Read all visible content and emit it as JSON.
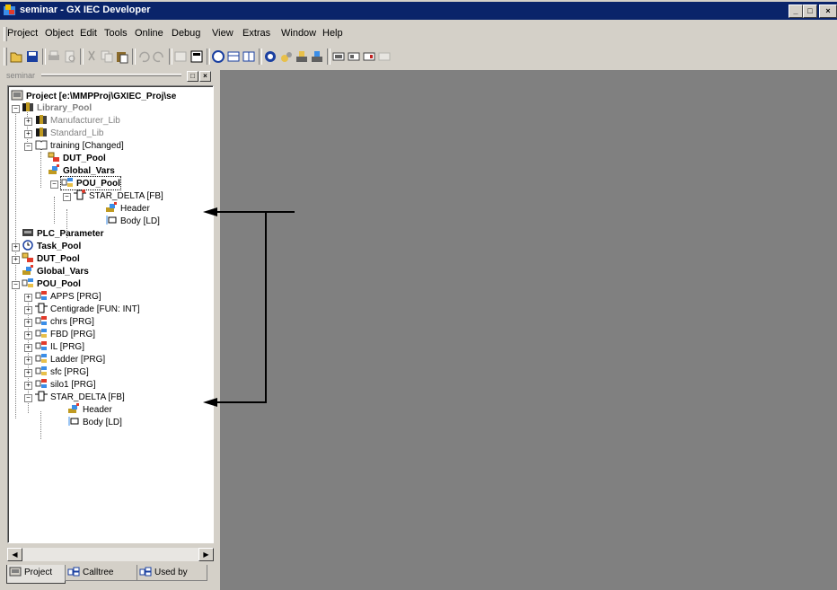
{
  "window": {
    "title": "seminar - GX IEC Developer",
    "controls": [
      "_",
      "□",
      "×"
    ]
  },
  "menu": [
    "Project",
    "Object",
    "Edit",
    "Tools",
    "Online",
    "Debug",
    "View",
    "Extras",
    "Window",
    "Help"
  ],
  "toolbar": {
    "icons": [
      "new-icon",
      "save-icon",
      "print-icon",
      "print-preview-icon",
      "cut-icon",
      "copy-icon",
      "paste-icon",
      "undo-icon",
      "redo-icon",
      "open-object-icon",
      "compile-icon",
      "monitor-icon",
      "entry-data-monitor-icon",
      "watch-icon",
      "online-icon",
      "transfer-icon",
      "download-icon",
      "upload-icon",
      "device-edit-icon",
      "variable-edit-icon",
      "cross-ref-icon",
      "disabled-icon"
    ]
  },
  "panel": {
    "title": "seminar",
    "tree": {
      "root": "Project [e:\\MMPProj\\GXIEC_Proj\\se",
      "library_pool": "Library_Pool",
      "manufacturer_lib": "Manufacturer_Lib",
      "standard_lib": "Standard_Lib",
      "training": "training [Changed]",
      "lib_dut_pool": "DUT_Pool",
      "lib_global_vars": "Global_Vars",
      "lib_pou_pool": "POU_Pool",
      "lib_star_delta": "STAR_DELTA [FB]",
      "lib_header": "Header",
      "lib_body": "Body [LD]",
      "plc_parameter": "PLC_Parameter",
      "task_pool": "Task_Pool",
      "dut_pool": "DUT_Pool",
      "global_vars": "Global_Vars",
      "pou_pool": "POU_Pool",
      "pous": [
        "APPS [PRG]",
        "Centigrade [FUN: INT]",
        "chrs [PRG]",
        "FBD [PRG]",
        "IL [PRG]",
        "Ladder [PRG]",
        "sfc [PRG]",
        "silo1 [PRG]"
      ],
      "star_delta": "STAR_DELTA [FB]",
      "header": "Header",
      "body": "Body [LD]"
    },
    "tabs": [
      "Project",
      "Calltree",
      "Used by"
    ]
  },
  "colors": {
    "titlebar": "#0a246a",
    "face": "#d4d0c8",
    "workspace": "#808080",
    "arrow": "#000000"
  }
}
